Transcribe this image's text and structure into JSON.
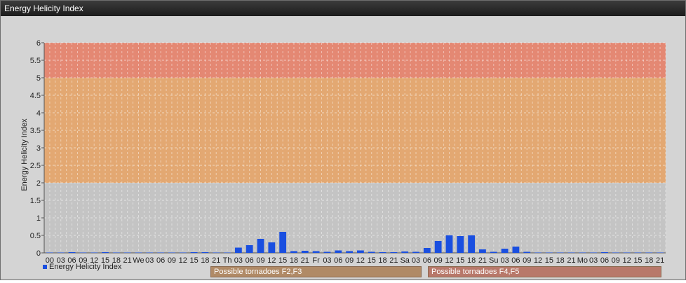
{
  "window": {
    "title": "Energy Helicity Index"
  },
  "chart_data": {
    "type": "bar",
    "title": "",
    "ylabel": "Energy Helicity Index",
    "xlabel": "",
    "ylim": [
      0,
      6
    ],
    "yticks": [
      "0",
      "0.5",
      "1",
      "1.5",
      "2",
      "2.5",
      "3",
      "3.5",
      "4",
      "4.5",
      "5",
      "5.5",
      "6"
    ],
    "categories": [
      "00",
      "03",
      "06",
      "09",
      "12",
      "15",
      "18",
      "21",
      "We",
      "03",
      "06",
      "09",
      "12",
      "15",
      "18",
      "21",
      "Th",
      "03",
      "06",
      "09",
      "12",
      "15",
      "18",
      "21",
      "Fr",
      "03",
      "06",
      "09",
      "12",
      "15",
      "18",
      "21",
      "Sa",
      "03",
      "06",
      "09",
      "12",
      "15",
      "18",
      "21",
      "Su",
      "03",
      "06",
      "09",
      "12",
      "15",
      "18",
      "21",
      "Mo",
      "03",
      "06",
      "09",
      "12",
      "15",
      "18",
      "21"
    ],
    "series": [
      {
        "name": "Energy Helicity Index",
        "color": "#1a4fe0",
        "values": [
          0.01,
          0.01,
          0.02,
          0.01,
          0.01,
          0.02,
          0.01,
          0.01,
          0.01,
          0.01,
          0.01,
          0.01,
          0.01,
          0.02,
          0.02,
          0.01,
          0.01,
          0.15,
          0.22,
          0.4,
          0.3,
          0.6,
          0.05,
          0.06,
          0.05,
          0.03,
          0.07,
          0.05,
          0.07,
          0.03,
          0.02,
          0.02,
          0.04,
          0.03,
          0.14,
          0.34,
          0.5,
          0.48,
          0.5,
          0.1,
          0.03,
          0.12,
          0.18,
          0.03,
          0.01,
          0.01,
          0.01,
          0.01,
          0.01,
          0.01,
          0.02,
          0.01,
          0.01,
          0.01,
          0.01,
          0.01
        ]
      }
    ],
    "bands": [
      {
        "from": 2,
        "to": 5,
        "color": "#e3a872"
      },
      {
        "from": 5,
        "to": 6,
        "color": "#e48873"
      }
    ],
    "grid": true,
    "legend": "bottom-left",
    "annotations": [
      "Possible tornadoes F2,F3",
      "Possible tornadoes F4,F5"
    ]
  }
}
